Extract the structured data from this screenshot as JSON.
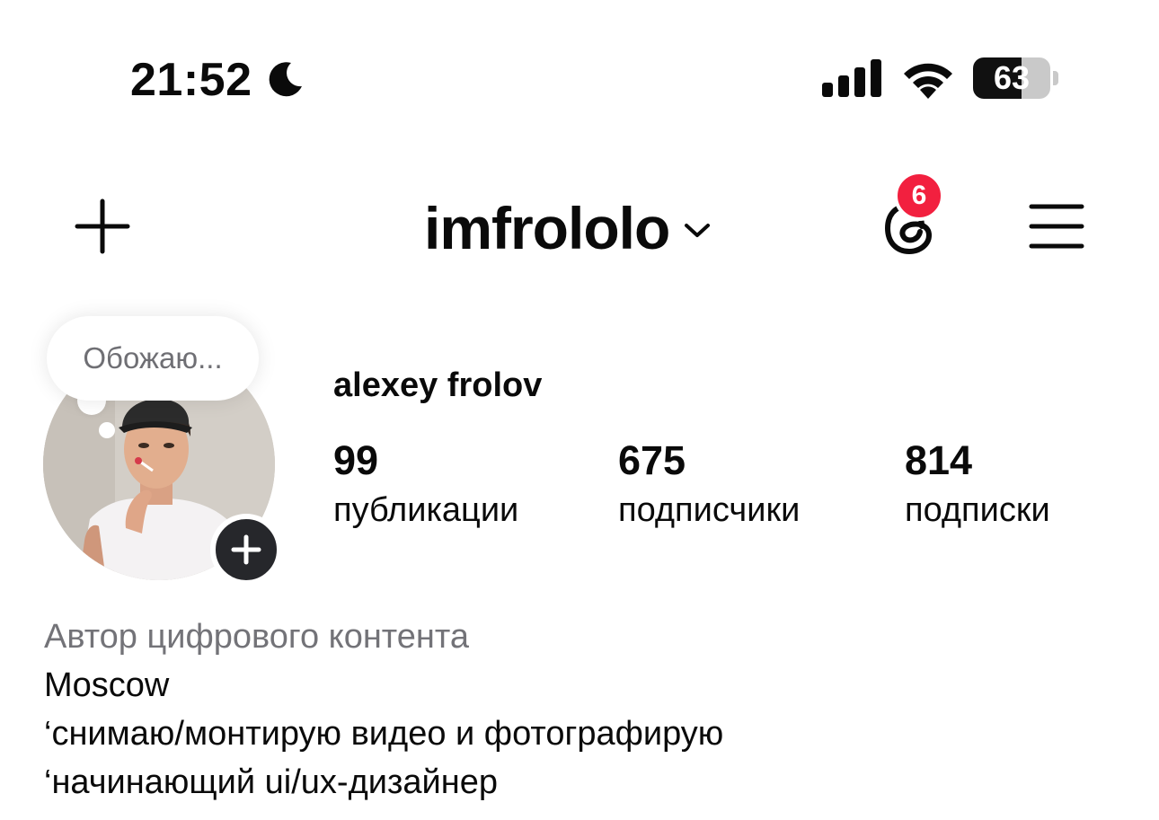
{
  "status_bar": {
    "time": "21:52",
    "battery": "63",
    "icons": [
      "moon-icon",
      "cellular-signal-icon",
      "wifi-icon",
      "battery-icon"
    ]
  },
  "header": {
    "username": "imfrololo",
    "threads_badge_count": "6",
    "icons": [
      "plus-icon",
      "chevron-down-icon",
      "threads-icon",
      "hamburger-menu-icon"
    ]
  },
  "profile": {
    "note": "Обожаю...",
    "full_name": "alexey frolov",
    "stats": [
      {
        "value": "99",
        "label": "публикации"
      },
      {
        "value": "675",
        "label": "подписчики"
      },
      {
        "value": "814",
        "label": "подписки"
      }
    ]
  },
  "bio": {
    "category": "Автор цифрового контента",
    "lines": [
      "Moscow",
      "‘снимаю/монтирую видео и фотографирую",
      "‘начинающий ui/ux-дизайнер"
    ]
  },
  "colors": {
    "badge": "#f2203f",
    "text_primary": "#0a0a0a",
    "text_secondary": "#737378",
    "add_story_button": "#26272b"
  }
}
